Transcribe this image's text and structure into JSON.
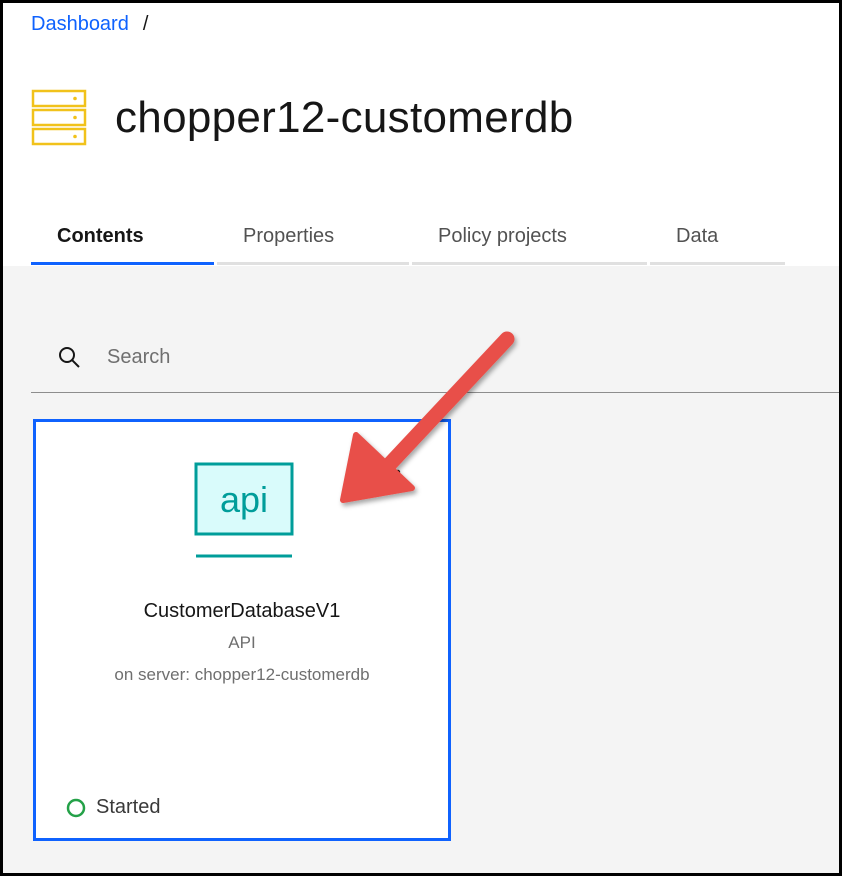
{
  "breadcrumb": {
    "root": "Dashboard",
    "separator": "/"
  },
  "header": {
    "title": "chopper12-customerdb",
    "icon": "server-stack-icon"
  },
  "tabs": [
    {
      "label": "Contents",
      "active": true
    },
    {
      "label": "Properties",
      "active": false
    },
    {
      "label": "Policy projects",
      "active": false
    },
    {
      "label": "Data",
      "active": false
    }
  ],
  "search": {
    "placeholder": "Search"
  },
  "card": {
    "icon_text": "api",
    "name": "CustomerDatabaseV1",
    "type": "API",
    "server": "on server: chopper12-customerdb",
    "status": "Started"
  },
  "colors": {
    "accent": "#0f62fe",
    "icon_yellow": "#f1c21b",
    "api_teal": "#009d9a",
    "api_fill": "#d9fbfb",
    "status_green": "#24a148",
    "arrow_red": "#e8504a"
  }
}
